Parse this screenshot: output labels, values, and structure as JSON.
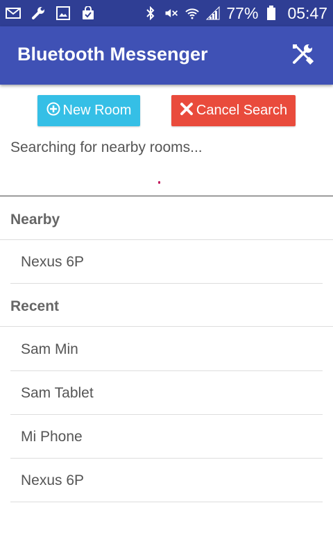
{
  "status_bar": {
    "icons_left": [
      "gmail-icon",
      "wrench-icon",
      "image-icon",
      "shopping-bag-icon"
    ],
    "icons_right": [
      "bluetooth-icon",
      "mute-icon",
      "wifi-icon",
      "signal-icon",
      "battery-icon"
    ],
    "battery": "77%",
    "time": "05:47"
  },
  "app_bar": {
    "title": "Bluetooth Messenger",
    "settings_icon": "tools-icon"
  },
  "actions": {
    "new_room": "New Room",
    "cancel_search": "Cancel Search"
  },
  "search": {
    "status": "Searching for nearby rooms..."
  },
  "sections": {
    "nearby": {
      "title": "Nearby",
      "items": [
        "Nexus 6P"
      ]
    },
    "recent": {
      "title": "Recent",
      "items": [
        "Sam Min",
        "Sam Tablet",
        "Mi Phone",
        "Nexus 6P"
      ]
    }
  },
  "colors": {
    "status_bar": "#2f3e94",
    "app_bar": "#3f51b5",
    "new_room_button": "#35bfe6",
    "cancel_button": "#e94b3c"
  }
}
